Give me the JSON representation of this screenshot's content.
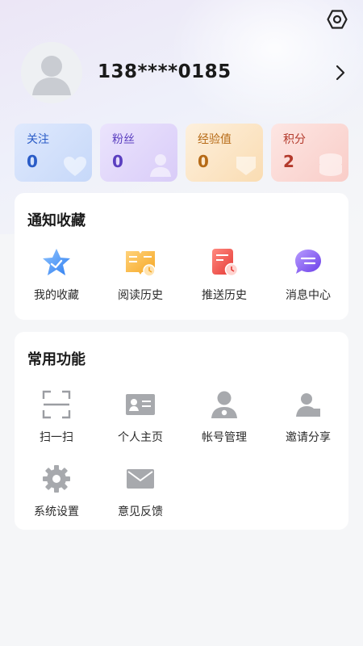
{
  "header": {
    "settings_icon": "settings-hexagon-icon"
  },
  "profile": {
    "username": "138****0185",
    "avatar_icon": "default-avatar-icon",
    "arrow_icon": "chevron-right-icon"
  },
  "stats": [
    {
      "label": "关注",
      "value": "0",
      "color": "#2a5cc7"
    },
    {
      "label": "粉丝",
      "value": "0",
      "color": "#5b3fc0"
    },
    {
      "label": "经验值",
      "value": "0",
      "color": "#b66a16"
    },
    {
      "label": "积分",
      "value": "2",
      "color": "#b33a2c"
    }
  ],
  "notify_section": {
    "title": "通知收藏",
    "items": [
      {
        "label": "我的收藏",
        "icon": "star-icon"
      },
      {
        "label": "阅读历史",
        "icon": "book-icon"
      },
      {
        "label": "推送历史",
        "icon": "push-history-icon"
      },
      {
        "label": "消息中心",
        "icon": "message-icon"
      }
    ]
  },
  "common_section": {
    "title": "常用功能",
    "items": [
      {
        "label": "扫一扫",
        "icon": "scan-icon"
      },
      {
        "label": "个人主页",
        "icon": "id-card-icon"
      },
      {
        "label": "帐号管理",
        "icon": "account-manage-icon"
      },
      {
        "label": "邀请分享",
        "icon": "invite-share-icon"
      },
      {
        "label": "系统设置",
        "icon": "gear-icon"
      },
      {
        "label": "意见反馈",
        "icon": "mail-icon"
      }
    ]
  }
}
